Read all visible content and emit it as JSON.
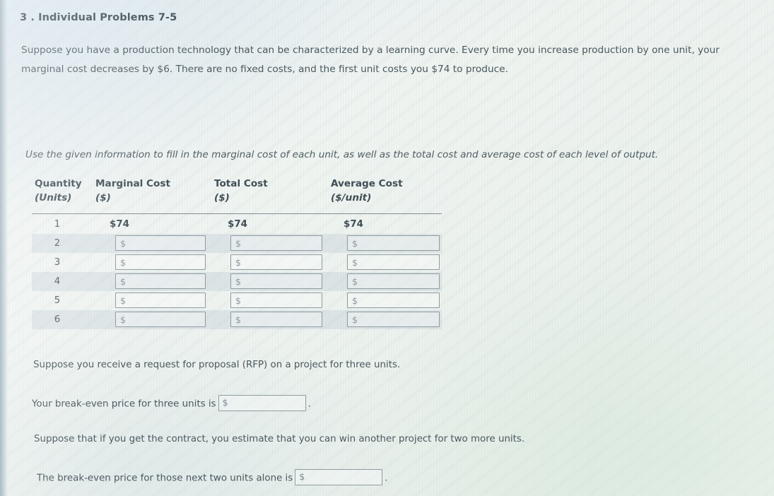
{
  "question": {
    "number": "3 .",
    "title": "Individual Problems 7-5",
    "intro": "Suppose you have a production technology that can be characterized by a learning curve. Every time you increase production by one unit, your marginal cost decreases by $6. There are no fixed costs, and the first unit costs you $74 to produce.",
    "instruction": "Use the given information to fill in the marginal cost of each unit, as well as the total cost and average cost of each level of output."
  },
  "table": {
    "headers": [
      {
        "title": "Quantity",
        "units": "(Units)"
      },
      {
        "title": "Marginal Cost",
        "units": "($)"
      },
      {
        "title": "Total Cost",
        "units": "($)"
      },
      {
        "title": "Average Cost",
        "units": "($/unit)"
      }
    ],
    "rows": [
      {
        "quantity": "1",
        "marginal_cost": "$74",
        "total_cost": "$74",
        "average_cost": "$74",
        "editable": false
      },
      {
        "quantity": "2",
        "marginal_cost": "",
        "total_cost": "",
        "average_cost": "",
        "editable": true
      },
      {
        "quantity": "3",
        "marginal_cost": "",
        "total_cost": "",
        "average_cost": "",
        "editable": true
      },
      {
        "quantity": "4",
        "marginal_cost": "",
        "total_cost": "",
        "average_cost": "",
        "editable": true
      },
      {
        "quantity": "5",
        "marginal_cost": "",
        "total_cost": "",
        "average_cost": "",
        "editable": true
      },
      {
        "quantity": "6",
        "marginal_cost": "",
        "total_cost": "",
        "average_cost": "",
        "editable": true
      }
    ],
    "currency_prefix": "$"
  },
  "prompts": {
    "rfp": "Suppose you receive a request for proposal (RFP) on a project for three units.",
    "breakeven_three_prefix": "Your break-even price for three units is",
    "breakeven_three_value": "",
    "contract": "Suppose that if you get the contract, you estimate that you can win another project for two more units.",
    "breakeven_two_prefix": "The break-even price for those next two units alone is",
    "breakeven_two_value": "",
    "period": ".",
    "currency_prefix": "$"
  },
  "colors": {
    "background": "#eef2f2",
    "text": "#4a585e",
    "heading": "#3d4c54",
    "rule": "#6d7d84",
    "field_border": "#8e9ba2",
    "row_stripe": "#a0b2c4"
  }
}
